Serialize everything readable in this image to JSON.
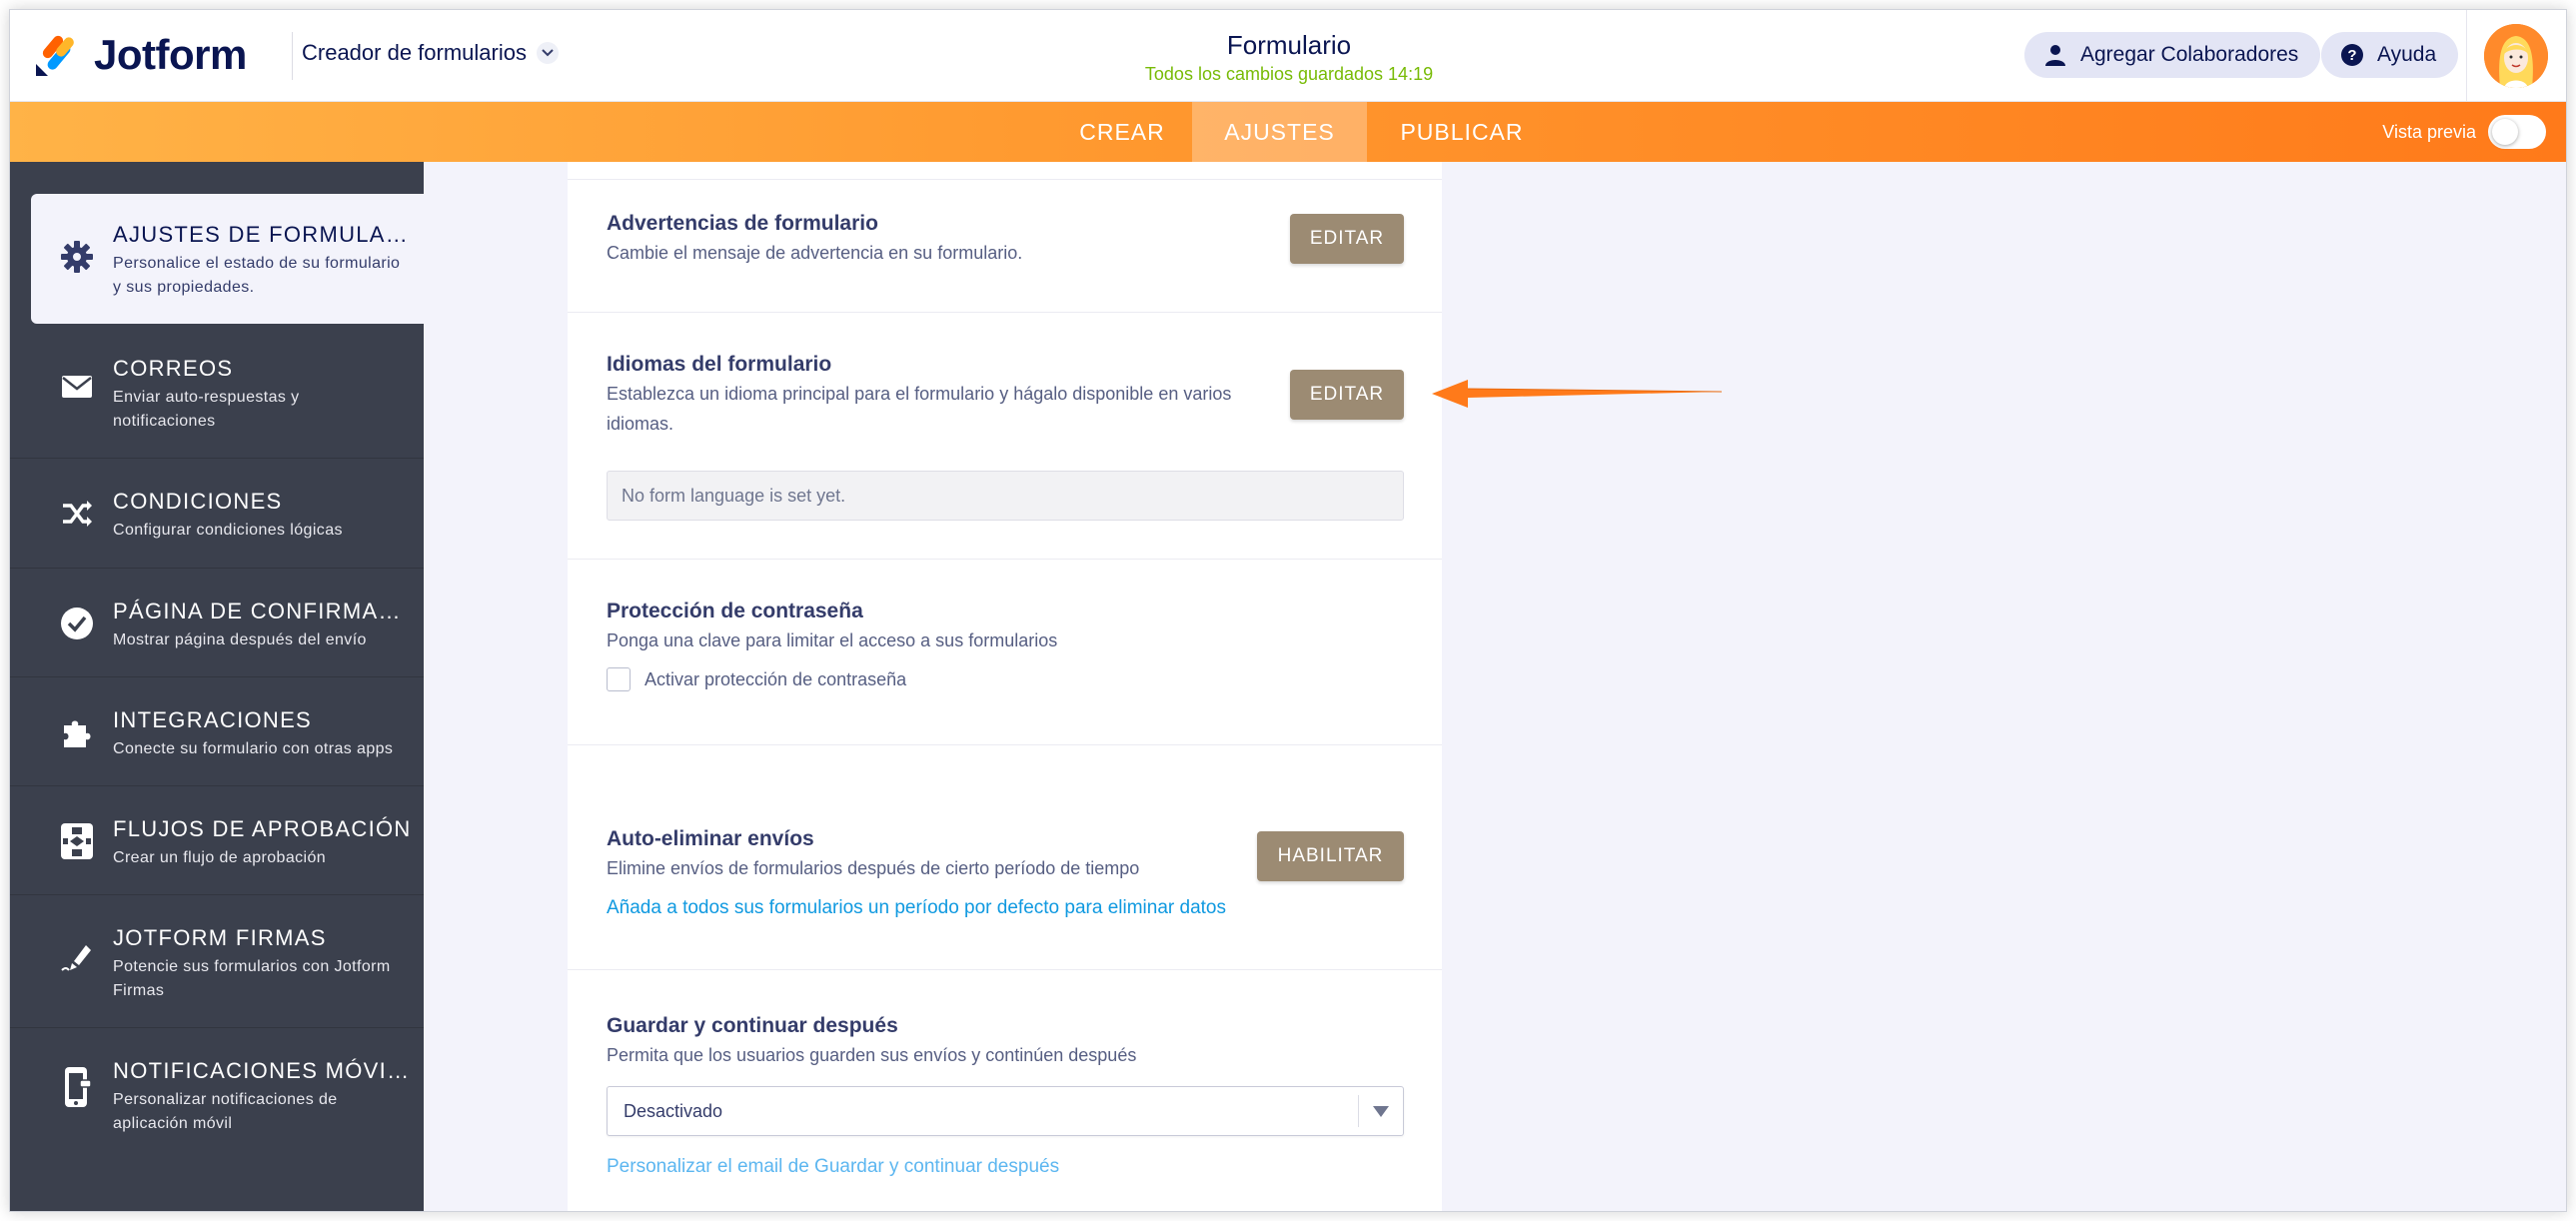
{
  "header": {
    "brand": "Jotform",
    "creator_label": "Creador de formularios",
    "form_title": "Formulario",
    "save_status": "Todos los cambios guardados 14:19",
    "collaborators_label": "Agregar Colaboradores",
    "help_label": "Ayuda"
  },
  "nav": {
    "tabs": [
      {
        "label": "CREAR"
      },
      {
        "label": "AJUSTES"
      },
      {
        "label": "PUBLICAR"
      }
    ],
    "active_tab": "AJUSTES",
    "preview_label": "Vista previa",
    "preview_on": false
  },
  "sidebar": {
    "items": [
      {
        "title": "AJUSTES DE FORMULARIO",
        "desc": "Personalice el estado de su formulario y sus propiedades.",
        "icon": "gear-icon"
      },
      {
        "title": "CORREOS",
        "desc": "Enviar auto-respuestas y notificaciones",
        "icon": "envelope-icon"
      },
      {
        "title": "CONDICIONES",
        "desc": "Configurar condiciones lógicas",
        "icon": "shuffle-icon"
      },
      {
        "title": "PÁGINA DE CONFIRMACI...",
        "desc": "Mostrar página después del envío",
        "icon": "check-circle-icon"
      },
      {
        "title": "INTEGRACIONES",
        "desc": "Conecte su formulario con otras apps",
        "icon": "puzzle-icon"
      },
      {
        "title": "FLUJOS DE APROBACIÓN",
        "desc": "Crear un flujo de aprobación",
        "icon": "flow-icon"
      },
      {
        "title": "JOTFORM FIRMAS",
        "desc": "Potencie sus formularios con Jotform Firmas",
        "icon": "pen-icon"
      },
      {
        "title": "NOTIFICACIONES MÓVIL...",
        "desc": "Personalizar notificaciones de aplicación móvil",
        "icon": "mobile-icon"
      }
    ]
  },
  "sections": {
    "warnings": {
      "title": "Advertencias de formulario",
      "desc": "Cambie el mensaje de advertencia en su formulario.",
      "button": "EDITAR"
    },
    "languages": {
      "title": "Idiomas del formulario",
      "desc": "Establezca un idioma principal para el formulario y hágalo disponible en varios idiomas.",
      "button": "EDITAR",
      "info": "No form language is set yet."
    },
    "password": {
      "title": "Protección de contraseña",
      "desc": "Ponga una clave para limitar el acceso a sus formularios",
      "checkbox_label": "Activar protección de contraseña",
      "checked": false
    },
    "auto_delete": {
      "title": "Auto-eliminar envíos",
      "desc": "Elimine envíos de formularios después de cierto período de tiempo",
      "button": "HABILITAR",
      "link": "Añada a todos sus formularios un período por defecto para eliminar datos"
    },
    "save_continue": {
      "title": "Guardar y continuar después",
      "desc": "Permita que los usuarios guarden sus envíos y continúen después",
      "select_value": "Desactivado",
      "link": "Personalizar el email de Guardar y continuar después"
    }
  },
  "colors": {
    "accent_orange": "#ff7a1a",
    "button_brown": "#9c8b73",
    "sidebar_bg": "#3b404d",
    "link_blue": "#0f99e0",
    "save_green": "#78bb07"
  }
}
